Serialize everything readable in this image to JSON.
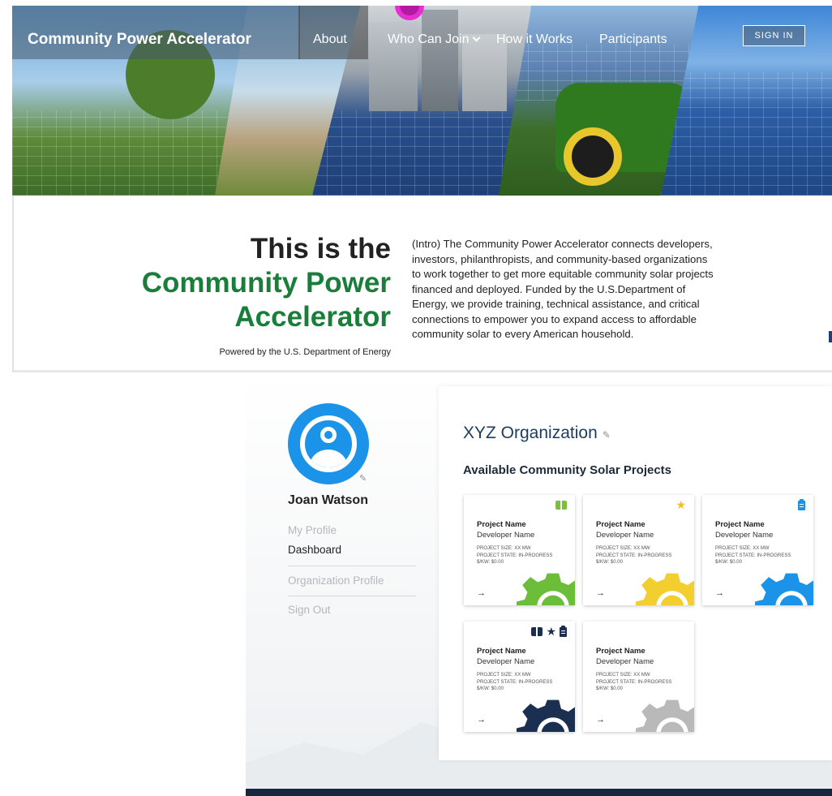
{
  "nav": {
    "brand": "Community Power Accelerator",
    "links": {
      "about": "About",
      "who_can_join": "Who Can Join",
      "how_it_works": "How it Works",
      "participants": "Participants"
    },
    "sign_in": "SIGN IN"
  },
  "intro": {
    "heading_line1": "This is the",
    "heading_line2": "Community Power",
    "heading_line3": "Accelerator",
    "powered_by": "Powered by the U.S. Department of Energy",
    "body": "(Intro) The Community Power Accelerator connects developers, investors, philanthropists, and community-based organizations to work together to get more equitable community solar projects financed and deployed. Funded by the U.S.Department of Energy, we provide training, technical assistance, and critical connections to empower you to expand access to affordable community solar to every American household."
  },
  "sidebar": {
    "user_name": "Joan Watson",
    "items": {
      "my_profile": "My Profile",
      "dashboard": "Dashboard",
      "organization_profile": "Organization Profile",
      "sign_out": "Sign Out"
    },
    "edit_glyph": "✎"
  },
  "org": {
    "name": "XYZ Organization",
    "edit_glyph": "✎",
    "projects_heading": "Available Community Solar Projects"
  },
  "projects": [
    {
      "name": "Project Name",
      "developer": "Developer Name",
      "size": "PROJECT SIZE: XX MW",
      "state": "PROJECT STATE: IN-PROGRESS",
      "rate": "$/KW: $0.00",
      "arrow": "→",
      "icons": [
        "book-icon"
      ],
      "gear_color": "#6cbd3a"
    },
    {
      "name": "Project Name",
      "developer": "Developer Name",
      "size": "PROJECT SIZE: XX MW",
      "state": "PROJECT STATE: IN-PROGRESS",
      "rate": "$/KW: $0.00",
      "arrow": "→",
      "icons": [
        "star-icon"
      ],
      "gear_color": "#f2cf2e"
    },
    {
      "name": "Project Name",
      "developer": "Developer Name",
      "size": "PROJECT SIZE: XX MW",
      "state": "PROJECT STATE: IN-PROGRESS",
      "rate": "$/KW: $0.00",
      "arrow": "→",
      "icons": [
        "clipboard-icon"
      ],
      "gear_color": "#1a93e8"
    },
    {
      "name": "Project Name",
      "developer": "Developer Name",
      "size": "PROJECT SIZE: XX MW",
      "state": "PROJECT STATE: IN-PROGRESS",
      "rate": "$/KW: $0.00",
      "arrow": "→",
      "icons": [
        "book-icon",
        "star-icon",
        "clipboard-icon"
      ],
      "gear_color": "#1b3050"
    },
    {
      "name": "Project Name",
      "developer": "Developer Name",
      "size": "PROJECT SIZE: XX MW",
      "state": "PROJECT STATE: IN-PROGRESS",
      "rate": "$/KW: $0.00",
      "arrow": "→",
      "icons": [],
      "gear_color": "#b9b9b9"
    }
  ],
  "colors": {
    "accent_green": "#1a7d3a",
    "navy": "#1d3b5e",
    "avatar_blue": "#1a93e8",
    "star_yellow": "#f5bd1f",
    "footer": "#17283c"
  }
}
